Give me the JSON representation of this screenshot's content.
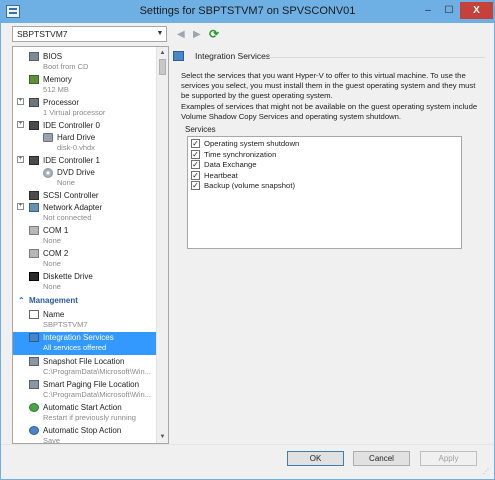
{
  "window": {
    "title": "Settings for SBPTSTVM7 on SPVSCONV01",
    "minimize_symbol": "–",
    "maximize_symbol": "☐",
    "close_symbol": "X"
  },
  "vm_selector": {
    "value": "SBPTSTVM7"
  },
  "toolbar": {
    "back_icon": "back-arrow-icon",
    "forward_icon": "forward-arrow-icon",
    "refresh_icon": "refresh-icon"
  },
  "tree": {
    "hardware_items": [
      {
        "label": "BIOS",
        "sub": "Boot from CD",
        "icon": "bios-icon",
        "expandable": false
      },
      {
        "label": "Memory",
        "sub": "512 MB",
        "icon": "memory-icon",
        "expandable": false
      },
      {
        "label": "Processor",
        "sub": "1 Virtual processor",
        "icon": "processor-icon",
        "expandable": true
      },
      {
        "label": "IDE Controller 0",
        "sub": "",
        "icon": "ide-controller-icon",
        "expandable": true
      },
      {
        "label": "Hard Drive",
        "sub": "disk-0.vhdx",
        "icon": "hard-drive-icon",
        "expandable": false
      },
      {
        "label": "IDE Controller 1",
        "sub": "",
        "icon": "ide-controller-icon",
        "expandable": true
      },
      {
        "label": "DVD Drive",
        "sub": "None",
        "icon": "dvd-drive-icon",
        "expandable": false
      },
      {
        "label": "SCSI Controller",
        "sub": "",
        "icon": "scsi-controller-icon",
        "expandable": false
      },
      {
        "label": "Network Adapter",
        "sub": "Not connected",
        "icon": "network-adapter-icon",
        "expandable": true
      },
      {
        "label": "COM 1",
        "sub": "None",
        "icon": "com-port-icon",
        "expandable": false
      },
      {
        "label": "COM 2",
        "sub": "None",
        "icon": "com-port-icon",
        "expandable": false
      },
      {
        "label": "Diskette Drive",
        "sub": "None",
        "icon": "diskette-drive-icon",
        "expandable": false
      }
    ],
    "management_header": "Management",
    "management_items": [
      {
        "label": "Name",
        "sub": "SBPTSTVM7",
        "icon": "name-icon"
      },
      {
        "label": "Integration Services",
        "sub": "All services offered",
        "icon": "integration-services-icon",
        "selected": true
      },
      {
        "label": "Snapshot File Location",
        "sub": "C:\\ProgramData\\Microsoft\\Win...",
        "icon": "snapshot-location-icon"
      },
      {
        "label": "Smart Paging File Location",
        "sub": "C:\\ProgramData\\Microsoft\\Win...",
        "icon": "smart-paging-icon"
      },
      {
        "label": "Automatic Start Action",
        "sub": "Restart if previously running",
        "icon": "automatic-start-icon"
      },
      {
        "label": "Automatic Stop Action",
        "sub": "Save",
        "icon": "automatic-stop-icon"
      }
    ]
  },
  "panel": {
    "title": "Integration Services",
    "description1": "Select the services that you want Hyper-V to offer to this virtual machine. To use the services you select, you must install them in the guest operating system and they must be supported by the guest operating system.",
    "description2": "Examples of services that might not be available on the guest operating system include Volume Shadow Copy Services and operating system shutdown.",
    "services_label": "Services",
    "services": [
      {
        "label": "Operating system shutdown",
        "checked": true
      },
      {
        "label": "Time synchronization",
        "checked": true
      },
      {
        "label": "Data Exchange",
        "checked": true
      },
      {
        "label": "Heartbeat",
        "checked": true
      },
      {
        "label": "Backup (volume snapshot)",
        "checked": true
      }
    ]
  },
  "buttons": {
    "ok": "OK",
    "cancel": "Cancel",
    "apply": "Apply"
  },
  "colors": {
    "titlebar": "#6fb0e4",
    "selection": "#3399ff",
    "close_button": "#c7413b",
    "management_header": "#2a5a9a"
  }
}
